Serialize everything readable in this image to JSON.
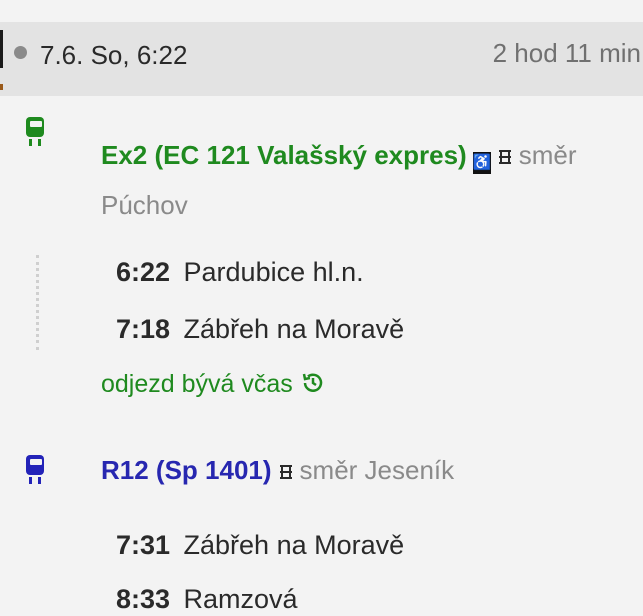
{
  "header": {
    "date": "7.6. So, 6:22",
    "duration": "2 hod 11 min"
  },
  "colors": {
    "green": "#1f8a1f",
    "blue": "#2727b0",
    "header_bg": "#e3e3e3"
  },
  "legs": [
    {
      "icon": "train-icon",
      "color": "green",
      "line": "Ex2 (EC 121 Valašský expres)",
      "icons": [
        "wheelchair-icon",
        "seat-reservation-icon"
      ],
      "direction_label": "směr",
      "direction": "Púchov",
      "stops": [
        {
          "time": "6:22",
          "name": "Pardubice hl.n."
        },
        {
          "time": "7:18",
          "name": "Zábřeh na Moravě"
        }
      ],
      "status": "odjezd bývá včas"
    },
    {
      "icon": "train-icon",
      "color": "blue",
      "line": "R12 (Sp 1401)",
      "icons": [
        "seat-reservation-icon"
      ],
      "direction_label": "směr Jeseník",
      "stops": [
        {
          "time": "7:31",
          "name": "Zábřeh na Moravě"
        },
        {
          "time": "8:33",
          "name": "Ramzová"
        }
      ]
    }
  ]
}
